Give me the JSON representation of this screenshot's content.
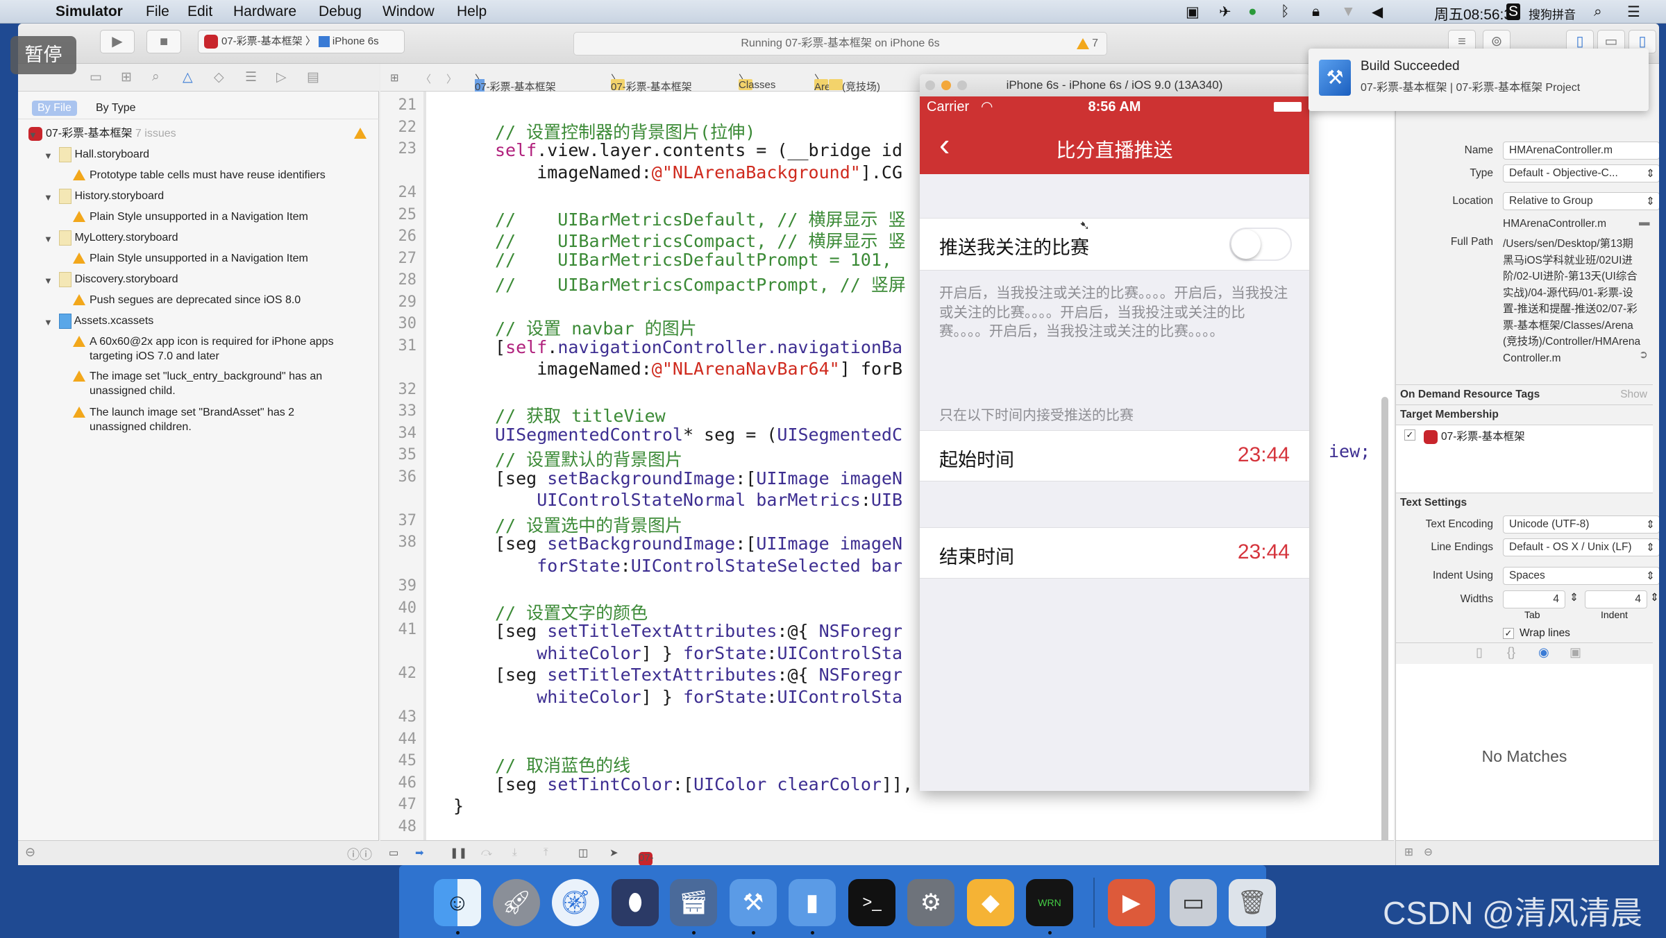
{
  "menubar": {
    "items": [
      "Simulator",
      "File",
      "Edit",
      "Hardware",
      "Debug",
      "Window",
      "Help"
    ],
    "clock": "周五08:56:30",
    "ime": "搜狗拼音"
  },
  "overlay": {
    "pause_label": "暂停"
  },
  "toolbar": {
    "scheme": "07-彩票-基本框架",
    "device": "iPhone 6s",
    "status": "Running 07-彩票-基本框架 on iPhone 6s",
    "warning_count": "7"
  },
  "navigator": {
    "scope_by_file": "By File",
    "scope_by_type": "By Type",
    "project": "07-彩票-基本框架",
    "issue_count": "7 issues",
    "groups": [
      {
        "name": "Hall.storyboard",
        "issues": [
          "Prototype table cells must have reuse identifiers"
        ]
      },
      {
        "name": "History.storyboard",
        "issues": [
          "Plain Style unsupported in a Navigation Item"
        ]
      },
      {
        "name": "MyLottery.storyboard",
        "issues": [
          "Plain Style unsupported in a Navigation Item"
        ]
      },
      {
        "name": "Discovery.storyboard",
        "issues": [
          "Push segues are deprecated since iOS 8.0"
        ]
      },
      {
        "name": "Assets.xcassets",
        "issues": [
          "A 60x60@2x app icon is required for iPhone apps targeting iOS 7.0 and later",
          "The image set \"luck_entry_background\" has an unassigned child.",
          "The launch image set \"BrandAsset\" has 2 unassigned children."
        ]
      }
    ]
  },
  "jumpbar": {
    "crumbs": [
      "07-彩票-基本框架",
      "07-彩票-基本框架",
      "Classes",
      "Arena(竞技场)"
    ]
  },
  "editor": {
    "rows": [
      {
        "n": "21",
        "segs": []
      },
      {
        "n": "22",
        "segs": [
          [
            "c",
            "// 设置控制器的背景图片(拉伸)"
          ]
        ]
      },
      {
        "n": "23",
        "segs": [
          [
            "k",
            "self"
          ],
          [
            "p",
            ".view.layer.contents = (__bridge id"
          ]
        ]
      },
      {
        "n": "",
        "segs": [
          [
            "p",
            "    imageNamed:"
          ],
          [
            "s",
            "@\"NLArenaBackground\""
          ],
          [
            "p",
            "].CG"
          ]
        ]
      },
      {
        "n": "24",
        "segs": []
      },
      {
        "n": "25",
        "segs": [
          [
            "c",
            "//    UIBarMetricsDefault, // 横屏显示 竖"
          ]
        ]
      },
      {
        "n": "26",
        "segs": [
          [
            "c",
            "//    UIBarMetricsCompact, // 横屏显示 竖"
          ]
        ]
      },
      {
        "n": "27",
        "segs": [
          [
            "c",
            "//    UIBarMetricsDefaultPrompt = 101,"
          ]
        ]
      },
      {
        "n": "28",
        "segs": [
          [
            "c",
            "//    UIBarMetricsCompactPrompt, // 竖屏"
          ]
        ]
      },
      {
        "n": "29",
        "segs": []
      },
      {
        "n": "30",
        "segs": [
          [
            "c",
            "// 设置 navbar 的图片"
          ]
        ]
      },
      {
        "n": "31",
        "segs": [
          [
            "p",
            "["
          ],
          [
            "k",
            "self"
          ],
          [
            "p",
            "."
          ],
          [
            "m",
            "navigationController.navigationBa"
          ]
        ]
      },
      {
        "n": "",
        "segs": [
          [
            "p",
            "    imageNamed:"
          ],
          [
            "s",
            "@\"NLArenaNavBar64\""
          ],
          [
            "p",
            "] forB"
          ]
        ]
      },
      {
        "n": "32",
        "segs": []
      },
      {
        "n": "33",
        "segs": [
          [
            "c",
            "// 获取 titleView"
          ]
        ]
      },
      {
        "n": "34",
        "segs": [
          [
            "m",
            "UISegmentedControl"
          ],
          [
            "p",
            "* seg = ("
          ],
          [
            "m",
            "UISegmentedC"
          ]
        ]
      },
      {
        "n": "35",
        "segs": [
          [
            "c",
            "// 设置默认的背景图片"
          ]
        ]
      },
      {
        "n": "36",
        "segs": [
          [
            "p",
            "[seg "
          ],
          [
            "m",
            "setBackgroundImage"
          ],
          [
            "p",
            ":["
          ],
          [
            "m",
            "UIImage imageN"
          ]
        ]
      },
      {
        "n": "",
        "segs": [
          [
            "p",
            "    "
          ],
          [
            "m",
            "UIControlStateNormal barMetrics"
          ],
          [
            "p",
            ":"
          ],
          [
            "m",
            "UIB"
          ]
        ]
      },
      {
        "n": "37",
        "segs": [
          [
            "c",
            "// 设置选中的背景图片"
          ]
        ]
      },
      {
        "n": "38",
        "segs": [
          [
            "p",
            "[seg "
          ],
          [
            "m",
            "setBackgroundImage"
          ],
          [
            "p",
            ":["
          ],
          [
            "m",
            "UIImage imageN"
          ]
        ]
      },
      {
        "n": "",
        "segs": [
          [
            "p",
            "    "
          ],
          [
            "m",
            "forState"
          ],
          [
            "p",
            ":"
          ],
          [
            "m",
            "UIControlStateSelected bar"
          ]
        ]
      },
      {
        "n": "39",
        "segs": []
      },
      {
        "n": "40",
        "segs": [
          [
            "c",
            "// 设置文字的颜色"
          ]
        ]
      },
      {
        "n": "41",
        "segs": [
          [
            "p",
            "[seg "
          ],
          [
            "m",
            "setTitleTextAttributes"
          ],
          [
            "p",
            ":@{ "
          ],
          [
            "m",
            "NSForegr"
          ]
        ]
      },
      {
        "n": "",
        "segs": [
          [
            "p",
            "    "
          ],
          [
            "m",
            "whiteColor"
          ],
          [
            "p",
            "] } "
          ],
          [
            "m",
            "forState"
          ],
          [
            "p",
            ":"
          ],
          [
            "m",
            "UIControlSta"
          ]
        ]
      },
      {
        "n": "42",
        "segs": [
          [
            "p",
            "[seg "
          ],
          [
            "m",
            "setTitleTextAttributes"
          ],
          [
            "p",
            ":@{ "
          ],
          [
            "m",
            "NSForegr"
          ]
        ]
      },
      {
        "n": "",
        "segs": [
          [
            "p",
            "    "
          ],
          [
            "m",
            "whiteColor"
          ],
          [
            "p",
            "] } "
          ],
          [
            "m",
            "forState"
          ],
          [
            "p",
            ":"
          ],
          [
            "m",
            "UIControlSta"
          ]
        ]
      },
      {
        "n": "43",
        "segs": []
      },
      {
        "n": "44",
        "segs": []
      },
      {
        "n": "45",
        "segs": [
          [
            "c",
            "// 取消蓝色的线"
          ]
        ]
      },
      {
        "n": "46",
        "segs": [
          [
            "p",
            "[seg "
          ],
          [
            "m",
            "setTintColor"
          ],
          [
            "p",
            ":["
          ],
          [
            "m",
            "UIColor clearColor"
          ],
          [
            "p",
            "]],"
          ]
        ]
      },
      {
        "n": "47",
        "segs": [
          [
            "p",
            "}"
          ]
        ],
        "outdent": true
      },
      {
        "n": "48",
        "segs": []
      }
    ],
    "overflow_34": "iew;",
    "debug_target": "07-彩票-基本框架"
  },
  "simulator": {
    "title": "iPhone 6s - iPhone 6s / iOS 9.0 (13A340)",
    "carrier": "Carrier",
    "time": "8:56 AM",
    "nav_title": "比分直播推送",
    "toggle_label": "推送我关注的比赛",
    "toggle_on": false,
    "footer": "开启后，当我投注或关注的比赛。。。。开启后，当我投注或关注的比赛。。。。开启后，当我投注或关注的比赛。。。。开启后，当我投注或关注的比赛。。。。",
    "section_header": "只在以下时间内接受推送的比赛",
    "start_label": "起始时间",
    "start_value": "23:44",
    "end_label": "结束时间",
    "end_value": "23:44",
    "accent": "#cd3232",
    "value_color": "#d5343c"
  },
  "notification": {
    "title": "Build Succeeded",
    "subtitle": "07-彩票-基本框架 | 07-彩票-基本框架 Project"
  },
  "inspector": {
    "name_label": "Name",
    "name": "HMArenaController.m",
    "type_label": "Type",
    "type": "Default - Objective-C...",
    "location_label": "Location",
    "location": "Relative to Group",
    "location_file": "HMArenaController.m",
    "full_path_label": "Full Path",
    "full_path": "/Users/sen/Desktop/第13期黑马iOS学科就业班/02UI进阶/02-UI进阶-第13天(UI综合实战)/04-源代码/01-彩票-设置-推送和提醒-推送02/07-彩票-基本框架/Classes/Arena(竞技场)/Controller/HMArenaController.m",
    "odr_label": "On Demand Resource Tags",
    "odr_show": "Show",
    "target_label": "Target Membership",
    "target": "07-彩票-基本框架",
    "target_checked": true,
    "text_settings_label": "Text Settings",
    "encoding_label": "Text Encoding",
    "encoding": "Unicode (UTF-8)",
    "line_endings_label": "Line Endings",
    "line_endings": "Default - OS X / Unix (LF)",
    "indent_using_label": "Indent Using",
    "indent_using": "Spaces",
    "widths_label": "Widths",
    "tab_width": "4",
    "indent_width": "4",
    "tab_label": "Tab",
    "indent_label": "Indent",
    "wrap_label": "Wrap lines",
    "wrap_checked": true,
    "no_matches": "No Matches"
  },
  "dock": {
    "apps": [
      "finder-icon",
      "launchpad-icon",
      "safari-icon",
      "mouse-app-icon",
      "video-app-icon",
      "xcode-icon",
      "simulator-icon",
      "terminal-icon",
      "system-preferences-icon",
      "sketch-icon",
      "console-icon",
      "media-app-icon",
      "screen-app-icon",
      "trash-icon"
    ]
  },
  "watermark": "CSDN @清风清晨"
}
